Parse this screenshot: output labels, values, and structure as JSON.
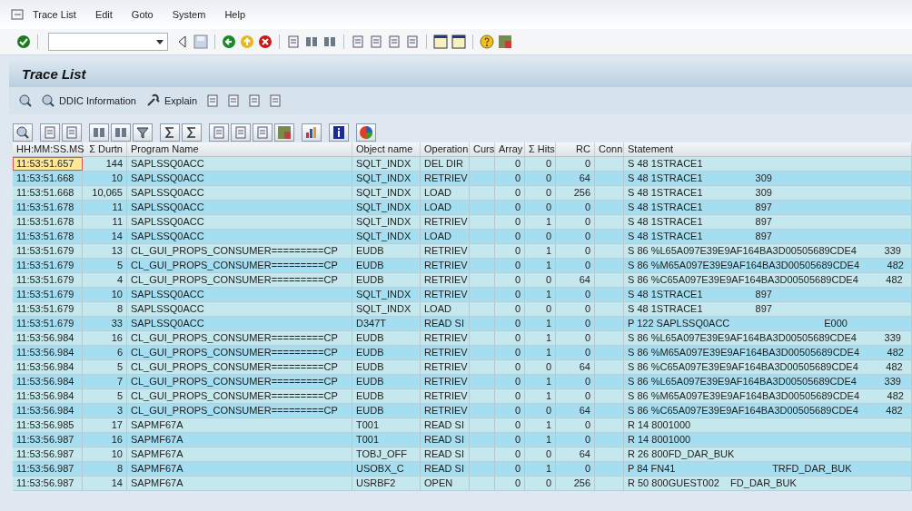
{
  "menu": [
    {
      "label": "Trace List"
    },
    {
      "label": "Edit"
    },
    {
      "label": "Goto"
    },
    {
      "label": "System"
    },
    {
      "label": "Help"
    }
  ],
  "screen_title": "Trace List",
  "app_toolbar": [
    {
      "kind": "icon"
    },
    {
      "kind": "button",
      "label": "DDIC Information"
    },
    {
      "kind": "button",
      "label": "Explain"
    },
    {
      "kind": "icon"
    },
    {
      "kind": "icon"
    },
    {
      "kind": "icon"
    },
    {
      "kind": "icon"
    }
  ],
  "columns": [
    {
      "label": "HH:MM:SS.MS"
    },
    {
      "label": "Σ Durtn"
    },
    {
      "label": "Program Name"
    },
    {
      "label": "Object name"
    },
    {
      "label": "Operation"
    },
    {
      "label": "Curs"
    },
    {
      "label": "Array"
    },
    {
      "label": "Σ Hits"
    },
    {
      "label": "RC"
    },
    {
      "label": "Conn"
    },
    {
      "label": "Statement"
    }
  ],
  "rows": [
    {
      "selected": true,
      "cells": [
        "11:53:51.657",
        "144",
        "SAPLSSQ0ACC",
        "SQLT_INDX",
        "DEL DIR",
        "",
        "0",
        "0",
        "0",
        "",
        "S 48 1STRACE1"
      ]
    },
    {
      "selected": false,
      "cells": [
        "11:53:51.668",
        "10",
        "SAPLSSQ0ACC",
        "SQLT_INDX",
        "RETRIEV",
        "",
        "0",
        "0",
        "64",
        "",
        "S 48 1STRACE1                   309"
      ]
    },
    {
      "selected": false,
      "cells": [
        "11:53:51.668",
        "10,065",
        "SAPLSSQ0ACC",
        "SQLT_INDX",
        "LOAD",
        "",
        "0",
        "0",
        "256",
        "",
        "S 48 1STRACE1                   309"
      ]
    },
    {
      "selected": false,
      "cells": [
        "11:53:51.678",
        "11",
        "SAPLSSQ0ACC",
        "SQLT_INDX",
        "LOAD",
        "",
        "0",
        "0",
        "0",
        "",
        "S 48 1STRACE1                   897"
      ]
    },
    {
      "selected": false,
      "cells": [
        "11:53:51.678",
        "11",
        "SAPLSSQ0ACC",
        "SQLT_INDX",
        "RETRIEV",
        "",
        "0",
        "1",
        "0",
        "",
        "S 48 1STRACE1                   897"
      ]
    },
    {
      "selected": false,
      "cells": [
        "11:53:51.678",
        "14",
        "SAPLSSQ0ACC",
        "SQLT_INDX",
        "LOAD",
        "",
        "0",
        "0",
        "0",
        "",
        "S 48 1STRACE1                   897"
      ]
    },
    {
      "selected": false,
      "cells": [
        "11:53:51.679",
        "13",
        "CL_GUI_PROPS_CONSUMER=========CP",
        "EUDB",
        "RETRIEV",
        "",
        "0",
        "1",
        "0",
        "",
        "S 86 %L65A097E39E9AF164BA3D00505689CDE4          339"
      ]
    },
    {
      "selected": false,
      "cells": [
        "11:53:51.679",
        "5",
        "CL_GUI_PROPS_CONSUMER=========CP",
        "EUDB",
        "RETRIEV",
        "",
        "0",
        "1",
        "0",
        "",
        "S 86 %M65A097E39E9AF164BA3D00505689CDE4          482"
      ]
    },
    {
      "selected": false,
      "cells": [
        "11:53:51.679",
        "4",
        "CL_GUI_PROPS_CONSUMER=========CP",
        "EUDB",
        "RETRIEV",
        "",
        "0",
        "0",
        "64",
        "",
        "S 86 %C65A097E39E9AF164BA3D00505689CDE4          482"
      ]
    },
    {
      "selected": false,
      "cells": [
        "11:53:51.679",
        "10",
        "SAPLSSQ0ACC",
        "SQLT_INDX",
        "RETRIEV",
        "",
        "0",
        "1",
        "0",
        "",
        "S 48 1STRACE1                   897"
      ]
    },
    {
      "selected": false,
      "cells": [
        "11:53:51.679",
        "8",
        "SAPLSSQ0ACC",
        "SQLT_INDX",
        "LOAD",
        "",
        "0",
        "0",
        "0",
        "",
        "S 48 1STRACE1                   897"
      ]
    },
    {
      "selected": false,
      "cells": [
        "11:53:51.679",
        "33",
        "SAPLSSQ0ACC",
        "D347T",
        "READ SI",
        "",
        "0",
        "1",
        "0",
        "",
        "P 122 SAPLSSQ0ACC                                  E000"
      ]
    },
    {
      "selected": false,
      "cells": [
        "11:53:56.984",
        "16",
        "CL_GUI_PROPS_CONSUMER=========CP",
        "EUDB",
        "RETRIEV",
        "",
        "0",
        "1",
        "0",
        "",
        "S 86 %L65A097E39E9AF164BA3D00505689CDE4          339"
      ]
    },
    {
      "selected": false,
      "cells": [
        "11:53:56.984",
        "6",
        "CL_GUI_PROPS_CONSUMER=========CP",
        "EUDB",
        "RETRIEV",
        "",
        "0",
        "1",
        "0",
        "",
        "S 86 %M65A097E39E9AF164BA3D00505689CDE4          482"
      ]
    },
    {
      "selected": false,
      "cells": [
        "11:53:56.984",
        "5",
        "CL_GUI_PROPS_CONSUMER=========CP",
        "EUDB",
        "RETRIEV",
        "",
        "0",
        "0",
        "64",
        "",
        "S 86 %C65A097E39E9AF164BA3D00505689CDE4          482"
      ]
    },
    {
      "selected": false,
      "cells": [
        "11:53:56.984",
        "7",
        "CL_GUI_PROPS_CONSUMER=========CP",
        "EUDB",
        "RETRIEV",
        "",
        "0",
        "1",
        "0",
        "",
        "S 86 %L65A097E39E9AF164BA3D00505689CDE4          339"
      ]
    },
    {
      "selected": false,
      "cells": [
        "11:53:56.984",
        "5",
        "CL_GUI_PROPS_CONSUMER=========CP",
        "EUDB",
        "RETRIEV",
        "",
        "0",
        "1",
        "0",
        "",
        "S 86 %M65A097E39E9AF164BA3D00505689CDE4          482"
      ]
    },
    {
      "selected": false,
      "cells": [
        "11:53:56.984",
        "3",
        "CL_GUI_PROPS_CONSUMER=========CP",
        "EUDB",
        "RETRIEV",
        "",
        "0",
        "0",
        "64",
        "",
        "S 86 %C65A097E39E9AF164BA3D00505689CDE4          482"
      ]
    },
    {
      "selected": false,
      "cells": [
        "11:53:56.985",
        "17",
        "SAPMF67A",
        "T001",
        "READ SI",
        "",
        "0",
        "1",
        "0",
        "",
        "R 14 8001000"
      ]
    },
    {
      "selected": false,
      "cells": [
        "11:53:56.987",
        "16",
        "SAPMF67A",
        "T001",
        "READ SI",
        "",
        "0",
        "1",
        "0",
        "",
        "R 14 8001000"
      ]
    },
    {
      "selected": false,
      "cells": [
        "11:53:56.987",
        "10",
        "SAPMF67A",
        "TOBJ_OFF",
        "READ SI",
        "",
        "0",
        "0",
        "64",
        "",
        "R 26 800FD_DAR_BUK"
      ]
    },
    {
      "selected": false,
      "cells": [
        "11:53:56.987",
        "8",
        "SAPMF67A",
        "USOBX_C",
        "READ SI",
        "",
        "0",
        "1",
        "0",
        "",
        "P 84 FN41                                   TRFD_DAR_BUK"
      ]
    },
    {
      "selected": false,
      "cells": [
        "11:53:56.987",
        "14",
        "SAPMF67A",
        "USRBF2",
        "OPEN",
        "",
        "0",
        "0",
        "256",
        "",
        "R 50 800GUEST002    FD_DAR_BUK"
      ]
    }
  ]
}
